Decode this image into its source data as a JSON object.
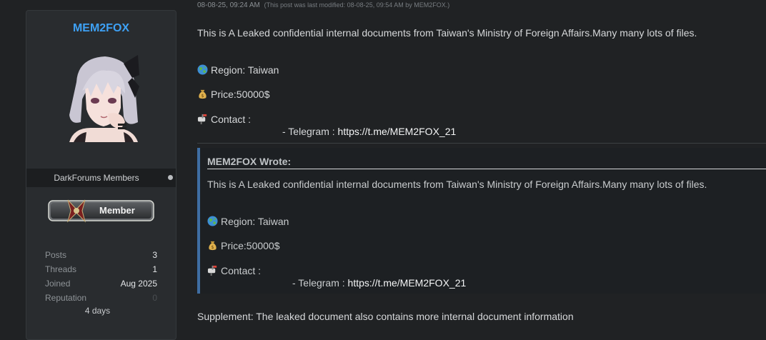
{
  "user": {
    "name": "MEM2FOX",
    "group": "DarkForums Members",
    "rank": "Member",
    "stats": [
      {
        "key": "Posts",
        "value": "3",
        "dim": false
      },
      {
        "key": "Threads",
        "value": "1",
        "dim": false
      },
      {
        "key": "Joined",
        "value": "Aug 2025",
        "dim": false
      },
      {
        "key": "Reputation",
        "value": "0",
        "dim": true
      }
    ],
    "sub": "4 days"
  },
  "post": {
    "date": "08-08-25, 09:24 AM",
    "edit_note": "(This post was last modified: 08-08-25, 09:54 AM by MEM2FOX.)",
    "intro": "This is A Leaked confidential internal documents from Taiwan's Ministry of Foreign Affairs.Many many lots of files.",
    "region": "Region:  Taiwan",
    "price": "Price:50000$",
    "contact": "Contact :",
    "telegram_prefix": "- Telegram : ",
    "telegram_link": "https://t.me/MEM2FOX_21",
    "supplement": "Supplement: The leaked document also contains more internal document information"
  },
  "quote": {
    "header": "MEM2FOX Wrote:",
    "intro": "This is A Leaked confidential internal documents from Taiwan's Ministry of Foreign Affairs.Many many lots of files.",
    "region": "Region:  Taiwan",
    "price": "Price:50000$",
    "contact": "Contact :",
    "telegram_prefix": "- Telegram : ",
    "telegram_link": "https://t.me/MEM2FOX_21"
  },
  "icons": {
    "region": "globe-icon",
    "price": "money-bag-icon",
    "contact": "mailbox-icon"
  },
  "colors": {
    "username": "#3ea1f5",
    "quote_border": "#3f6ea3"
  }
}
